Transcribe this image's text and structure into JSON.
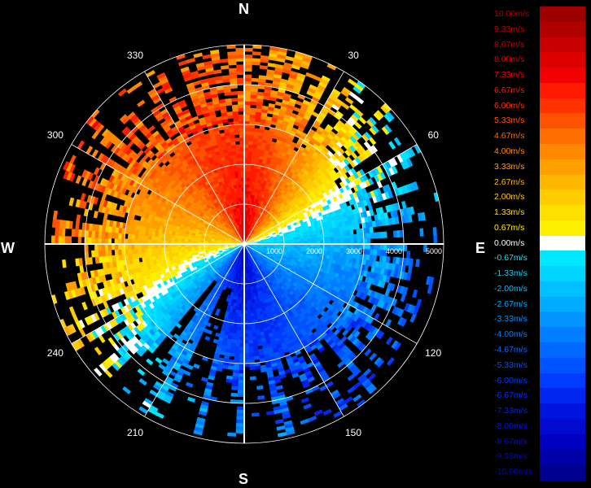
{
  "compass": {
    "north": "N",
    "south": "S",
    "east": "E",
    "west": "W"
  },
  "azimuth_labels": [
    {
      "deg": 30,
      "text": "30"
    },
    {
      "deg": 60,
      "text": "60"
    },
    {
      "deg": 120,
      "text": "120"
    },
    {
      "deg": 150,
      "text": "150"
    },
    {
      "deg": 210,
      "text": "210"
    },
    {
      "deg": 240,
      "text": "240"
    },
    {
      "deg": 300,
      "text": "300"
    },
    {
      "deg": 330,
      "text": "330"
    }
  ],
  "range_labels": [
    {
      "range_m": 1000,
      "text": "1000"
    },
    {
      "range_m": 2000,
      "text": "2000"
    },
    {
      "range_m": 3000,
      "text": "3000"
    },
    {
      "range_m": 4000,
      "text": "4000"
    },
    {
      "range_m": 5000,
      "text": "5000"
    }
  ],
  "legend": {
    "items": [
      {
        "label": "10.00m/s",
        "color": "#9e0000",
        "text_color": "#b00000"
      },
      {
        "label": "9.33m/s",
        "color": "#b00000",
        "text_color": "#c00000"
      },
      {
        "label": "8.67m/s",
        "color": "#c80000",
        "text_color": "#d00000"
      },
      {
        "label": "8.00m/s",
        "color": "#dc0000",
        "text_color": "#e00000"
      },
      {
        "label": "7.33m/s",
        "color": "#f00000",
        "text_color": "#f00000"
      },
      {
        "label": "6.67m/s",
        "color": "#ff1a00",
        "text_color": "#ff1a00"
      },
      {
        "label": "6.00m/s",
        "color": "#ff3300",
        "text_color": "#ff3300"
      },
      {
        "label": "5.33m/s",
        "color": "#ff5200",
        "text_color": "#ff5200"
      },
      {
        "label": "4.67m/s",
        "color": "#ff6e00",
        "text_color": "#ff6e00"
      },
      {
        "label": "4.00m/s",
        "color": "#ff8800",
        "text_color": "#ff8800"
      },
      {
        "label": "3.33m/s",
        "color": "#ffa000",
        "text_color": "#ffa000"
      },
      {
        "label": "2.67m/s",
        "color": "#ffb800",
        "text_color": "#ffb800"
      },
      {
        "label": "2.00m/s",
        "color": "#ffcc00",
        "text_color": "#ffcc00"
      },
      {
        "label": "1.33m/s",
        "color": "#ffdf00",
        "text_color": "#ffdf00"
      },
      {
        "label": "0.67m/s",
        "color": "#fff000",
        "text_color": "#fff000"
      },
      {
        "label": "0.00m/s",
        "color": "#ffffff",
        "text_color": "#ffffff"
      },
      {
        "label": "-0.67m/s",
        "color": "#00e8ff",
        "text_color": "#00e8ff"
      },
      {
        "label": "-1.33m/s",
        "color": "#00d4ff",
        "text_color": "#00d4ff"
      },
      {
        "label": "-2.00m/s",
        "color": "#00c0ff",
        "text_color": "#00c0ff"
      },
      {
        "label": "-2.67m/s",
        "color": "#00aaff",
        "text_color": "#00aaff"
      },
      {
        "label": "-3.33m/s",
        "color": "#0094ff",
        "text_color": "#0094ff"
      },
      {
        "label": "-4.00m/s",
        "color": "#007eff",
        "text_color": "#007eff"
      },
      {
        "label": "-4.67m/s",
        "color": "#0068ff",
        "text_color": "#0068ff"
      },
      {
        "label": "-5.33m/s",
        "color": "#0052ff",
        "text_color": "#0052ff"
      },
      {
        "label": "-6.00m/s",
        "color": "#003cff",
        "text_color": "#003cff"
      },
      {
        "label": "-6.67m/s",
        "color": "#0026f0",
        "text_color": "#0030ff"
      },
      {
        "label": "-7.33m/s",
        "color": "#0014e0",
        "text_color": "#0020ff"
      },
      {
        "label": "-8.00m/s",
        "color": "#000ad0",
        "text_color": "#0014f0"
      },
      {
        "label": "-8.67m/s",
        "color": "#0000c0",
        "text_color": "#000ce0"
      },
      {
        "label": "-9.33m/s",
        "color": "#0000a8",
        "text_color": "#0008d0"
      },
      {
        "label": "-10.00m/s",
        "color": "#000090",
        "text_color": "#0004c0"
      }
    ]
  },
  "chart_data": {
    "type": "heatmap",
    "projection": "polar",
    "quantity": "radial velocity",
    "units": "m/s",
    "azimuth_range_deg": [
      0,
      360
    ],
    "range_m": [
      0,
      5000
    ],
    "range_rings_m": [
      1000,
      2000,
      3000,
      4000,
      5000
    ],
    "color_range": [
      -10.0,
      10.0
    ],
    "pattern": "positive velocities (red/yellow) over the northern half, negative velocities (blue/cyan) over the southern half, zero-velocity line wavy near the east-west axis at about 500-1000 m",
    "approx_sectors": [
      {
        "azimuth_deg": 0,
        "near_value": 8.5,
        "far_value": 3.0
      },
      {
        "azimuth_deg": 45,
        "near_value": 6.0,
        "far_value": -3.0
      },
      {
        "azimuth_deg": 90,
        "near_value": -2.0,
        "far_value": -4.5
      },
      {
        "azimuth_deg": 135,
        "near_value": -7.0,
        "far_value": -5.0
      },
      {
        "azimuth_deg": 180,
        "near_value": -8.5,
        "far_value": -6.0
      },
      {
        "azimuth_deg": 225,
        "near_value": -4.0,
        "far_value": 2.5
      },
      {
        "azimuth_deg": 270,
        "near_value": -1.0,
        "far_value": 4.0
      },
      {
        "azimuth_deg": 315,
        "near_value": 7.5,
        "far_value": 6.5
      }
    ]
  }
}
